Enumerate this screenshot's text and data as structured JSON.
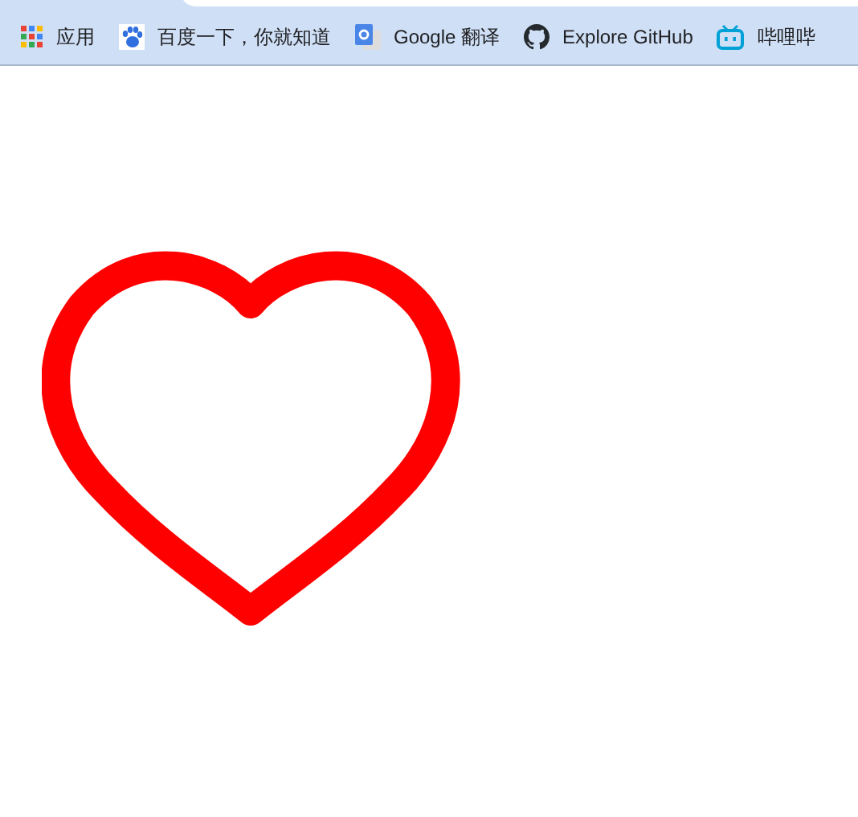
{
  "bookmarks_bar": [
    {
      "kind": "apps",
      "label": "应用"
    },
    {
      "kind": "paw",
      "label": "百度一下，你就知道"
    },
    {
      "kind": "translate",
      "label": "Google 翻译"
    },
    {
      "kind": "github",
      "label": "Explore GitHub"
    },
    {
      "kind": "tv",
      "label": "哔哩哔"
    }
  ]
}
